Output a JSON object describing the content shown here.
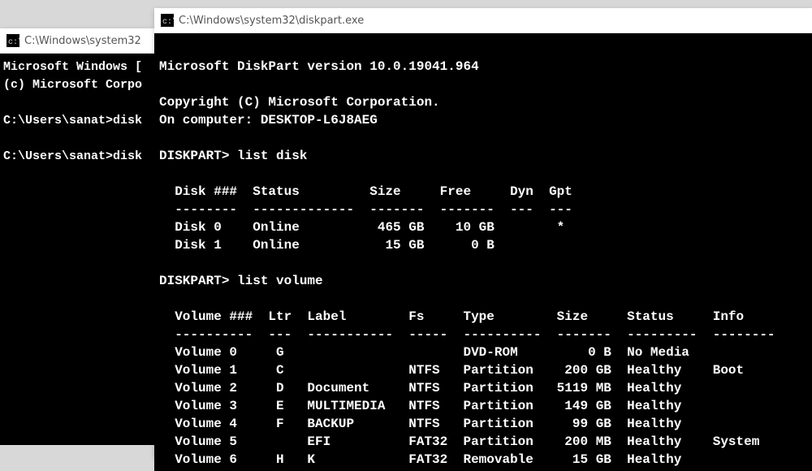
{
  "back_window": {
    "title": "C:\\Windows\\system32",
    "lines": "Microsoft Windows [\n(c) Microsoft Corpo\n\nC:\\Users\\sanat>disk\n\nC:\\Users\\sanat>disk"
  },
  "front_window": {
    "title": "C:\\Windows\\system32\\diskpart.exe",
    "intro": "\nMicrosoft DiskPart version 10.0.19041.964\n\nCopyright (C) Microsoft Corporation.\nOn computer: DESKTOP-L6J8AEG\n",
    "cmd1": "DISKPART> list disk",
    "disk_table": "\n  Disk ###  Status         Size     Free     Dyn  Gpt\n  --------  -------------  -------  -------  ---  ---\n  Disk 0    Online          465 GB    10 GB        *\n  Disk 1    Online           15 GB      0 B\n",
    "cmd2": "DISKPART> list volume",
    "volume_table": "\n  Volume ###  Ltr  Label        Fs     Type        Size     Status     Info\n  ----------  ---  -----------  -----  ----------  -------  ---------  --------\n  Volume 0     G                       DVD-ROM         0 B  No Media\n  Volume 1     C                NTFS   Partition    200 GB  Healthy    Boot\n  Volume 2     D   Document     NTFS   Partition   5119 MB  Healthy\n  Volume 3     E   MULTIMEDIA   NTFS   Partition    149 GB  Healthy\n  Volume 4     F   BACKUP       NTFS   Partition     99 GB  Healthy\n  Volume 5         EFI          FAT32  Partition    200 MB  Healthy    System\n  Volume 6     H   K            FAT32  Removable     15 GB  Healthy\n"
  }
}
